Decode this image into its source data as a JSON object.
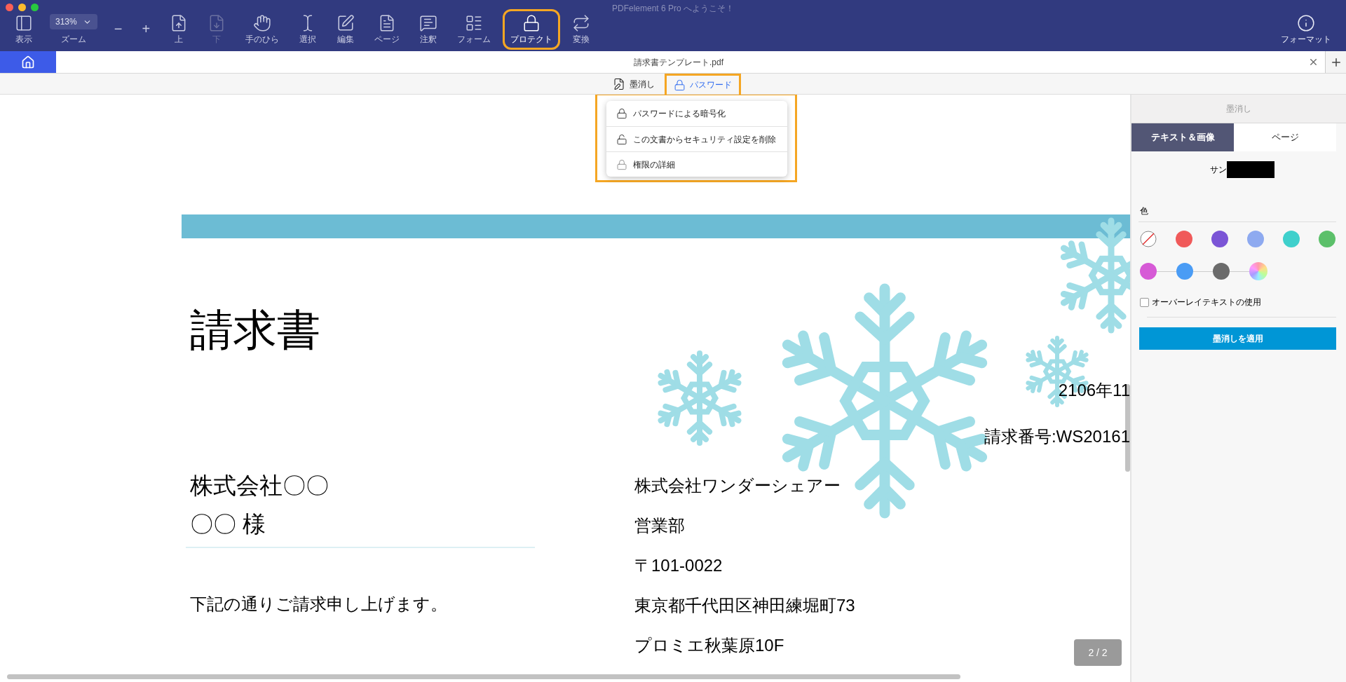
{
  "window": {
    "title": "PDFelement 6 Pro へようこそ！"
  },
  "toolbar": {
    "zoom": {
      "value": "313%",
      "label": "ズーム"
    },
    "items": [
      {
        "kind": "view",
        "label": "表示",
        "disabled": false,
        "selected": false
      },
      {
        "kind": "zoom-out",
        "label": "−",
        "disabled": false,
        "selected": false
      },
      {
        "kind": "zoom-in",
        "label": "+",
        "disabled": false,
        "selected": false
      },
      {
        "kind": "prev",
        "label": "上",
        "disabled": false,
        "selected": false
      },
      {
        "kind": "next",
        "label": "下",
        "disabled": true,
        "selected": false
      },
      {
        "kind": "hand",
        "label": "手のひら",
        "disabled": false,
        "selected": false
      },
      {
        "kind": "select",
        "label": "選択",
        "disabled": false,
        "selected": false
      },
      {
        "kind": "edit",
        "label": "編集",
        "disabled": false,
        "selected": false
      },
      {
        "kind": "page",
        "label": "ページ",
        "disabled": false,
        "selected": false
      },
      {
        "kind": "comment",
        "label": "注釈",
        "disabled": false,
        "selected": false
      },
      {
        "kind": "form",
        "label": "フォーム",
        "disabled": false,
        "selected": false
      },
      {
        "kind": "protect",
        "label": "プロテクト",
        "disabled": false,
        "selected": true
      },
      {
        "kind": "convert",
        "label": "変換",
        "disabled": false,
        "selected": false
      }
    ],
    "format": {
      "label": "フォーマット"
    }
  },
  "tab_bar": {
    "file_name": "請求書テンプレート.pdf"
  },
  "sub_toolbar": {
    "items": [
      {
        "kind": "redact",
        "label": "墨消し",
        "selected": false
      },
      {
        "kind": "password",
        "label": "パスワード",
        "selected": true
      }
    ]
  },
  "password_menu": {
    "items": [
      {
        "kind": "encrypt",
        "label": "パスワードによる暗号化"
      },
      {
        "kind": "remove",
        "label": "この文書からセキュリティ設定を削除"
      },
      {
        "kind": "details",
        "label": "権限の詳細"
      }
    ]
  },
  "document": {
    "title": "請求書",
    "date": "2106年11",
    "invoice_number": "請求番号:WS20161",
    "recipient_company": "株式会社〇〇",
    "recipient_name": "〇〇 様",
    "message": "下記の通りご請求申し上げます。",
    "sender_lines": [
      "株式会社ワンダーシェアー",
      "営業部",
      "〒101-0022",
      "東京都千代田区神田練堀町73",
      "プロミエ秋葉原10F"
    ],
    "page_indicator": "2 / 2"
  },
  "side_panel": {
    "header": "墨消し",
    "tabs": [
      {
        "label": "テキスト＆画像",
        "selected": true
      },
      {
        "label": "ページ",
        "selected": false
      }
    ],
    "sample_label": "サン",
    "color_label": "色",
    "colors": [
      {
        "kind": "none"
      },
      {
        "kind": "solid",
        "color": "#f05a5a"
      },
      {
        "kind": "solid",
        "color": "#7b55d6"
      },
      {
        "kind": "solid",
        "color": "#8eaaf0"
      },
      {
        "kind": "solid",
        "color": "#3fd0cc"
      },
      {
        "kind": "solid",
        "color": "#5cc06a"
      },
      {
        "kind": "solid",
        "color": "#d65ad6"
      },
      {
        "kind": "solid",
        "color": "#4a9cf5"
      },
      {
        "kind": "solid",
        "color": "#6b6b6b"
      },
      {
        "kind": "rainbow"
      }
    ],
    "overlay_checkbox": {
      "label": "オーバーレイテキストの使用",
      "checked": false
    },
    "apply_button": "墨消しを適用"
  }
}
